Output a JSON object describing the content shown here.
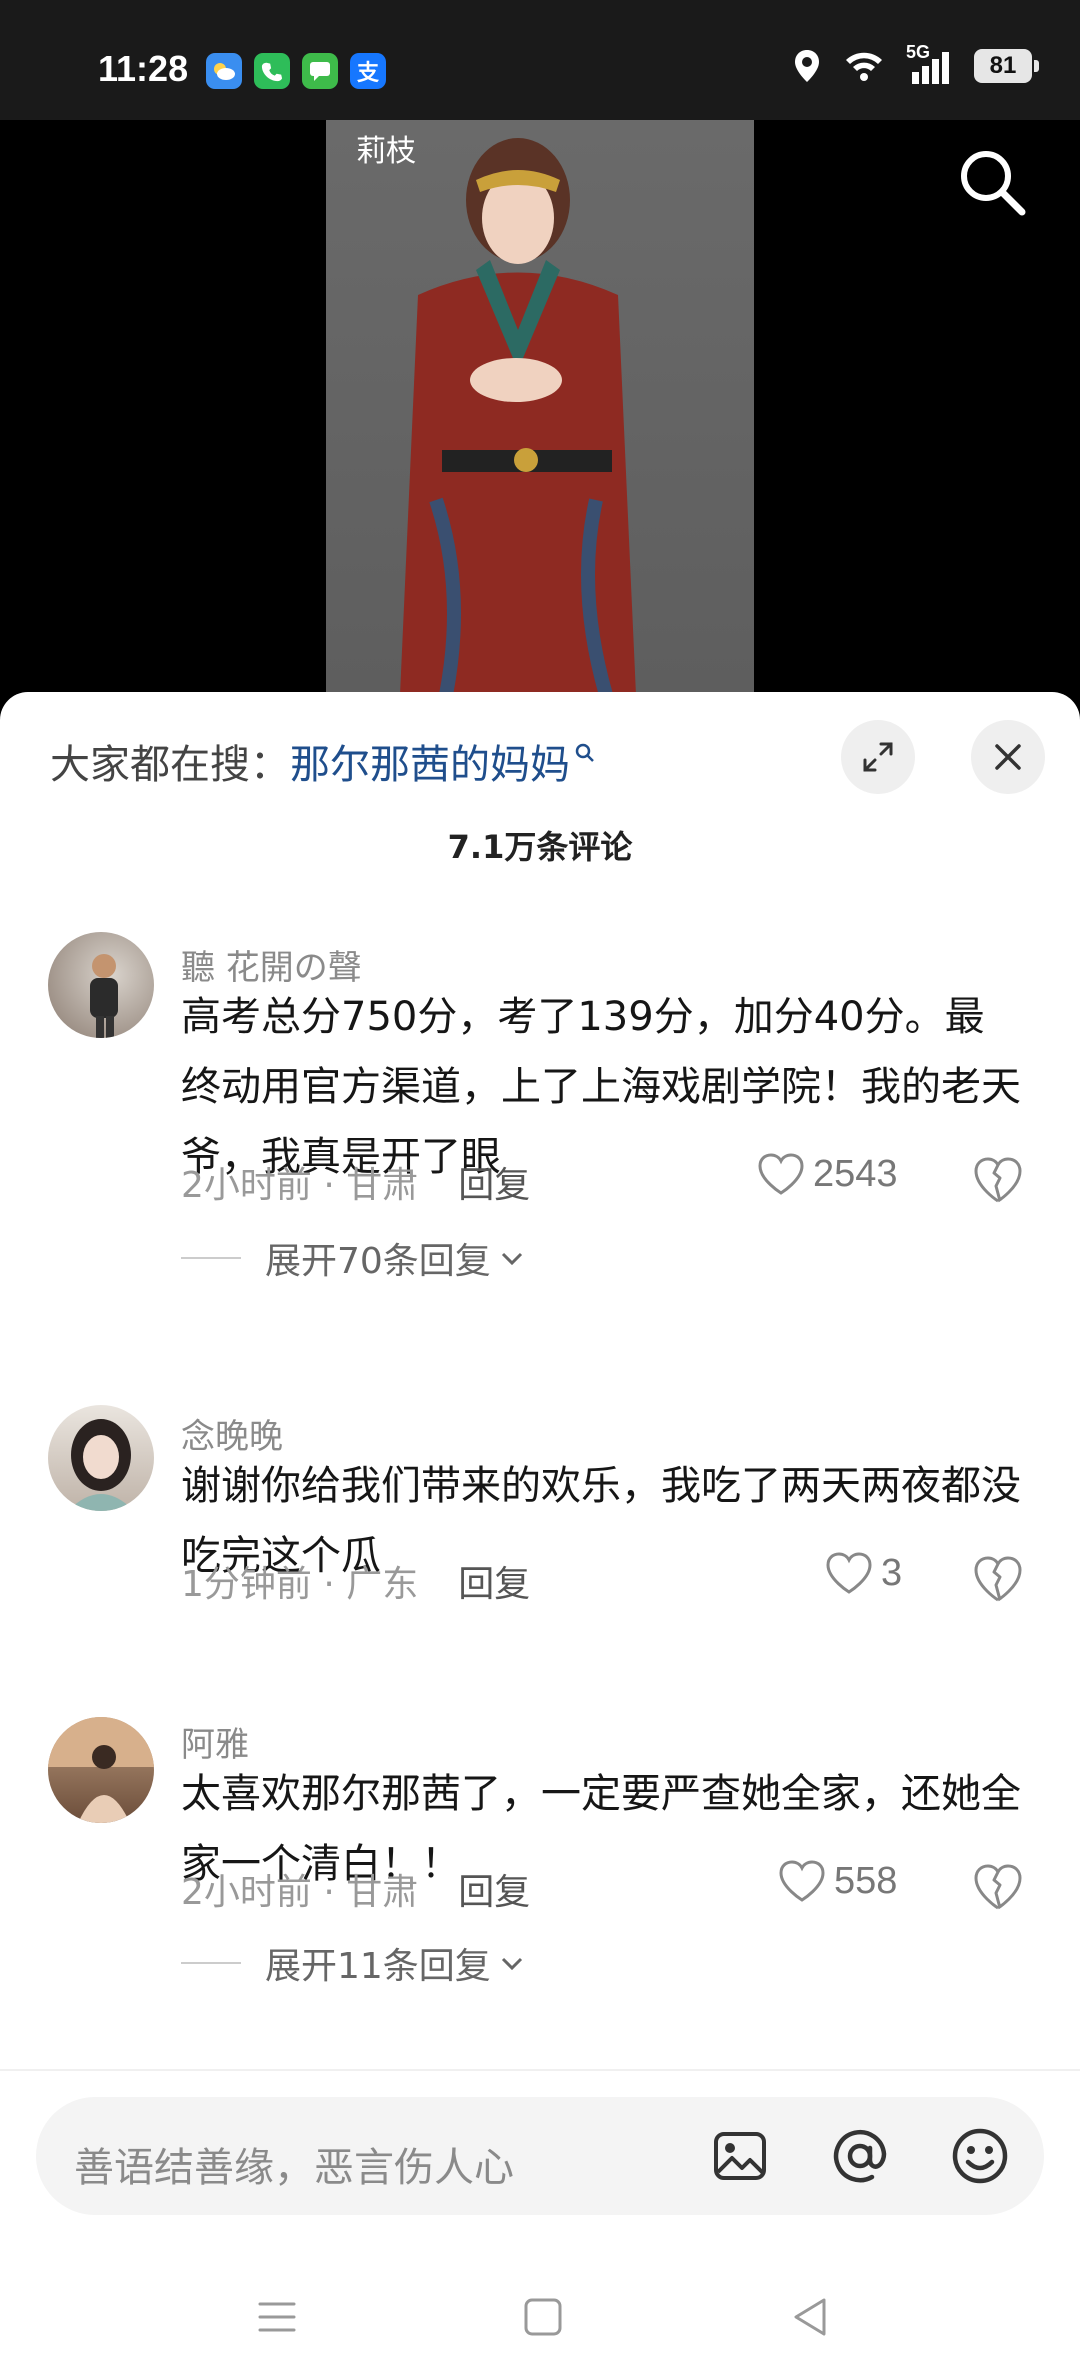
{
  "status_bar": {
    "time": "11:28",
    "app_icons": [
      "weather-icon",
      "phone-icon",
      "messages-icon",
      "alipay-icon"
    ],
    "network": "5G",
    "battery": "81"
  },
  "video": {
    "watermark": "莉枝"
  },
  "sheet": {
    "search_label": "大家都在搜：",
    "search_keyword": "那尔那茜的妈妈",
    "comment_count": "7.1万条评论"
  },
  "comments": [
    {
      "username": "聽 花開の聲",
      "text": "高考总分750分，考了139分，加分40分。最终动用官方渠道，上了上海戏剧学院！我的老天爷，我真是开了眼",
      "time_location": "2小时前 · 甘肃",
      "reply": "回复",
      "likes": "2543",
      "expand": "展开70条回复"
    },
    {
      "username": "念晚晚",
      "text": "谢谢你给我们带来的欢乐，我吃了两天两夜都没吃完这个瓜",
      "time_location": "1分钟前 · 广东",
      "reply": "回复",
      "likes": "3"
    },
    {
      "username": "阿雅",
      "text": "太喜欢那尔那茜了，一定要严查她全家，还她全家一个清白！！",
      "time_location": "2小时前 · 甘肃",
      "reply": "回复",
      "likes": "558",
      "expand": "展开11条回复"
    }
  ],
  "input": {
    "placeholder": "善语结善缘，恶言伤人心"
  },
  "colors": {
    "keyword": "#1f4e8c",
    "secondary_text": "#999999"
  }
}
